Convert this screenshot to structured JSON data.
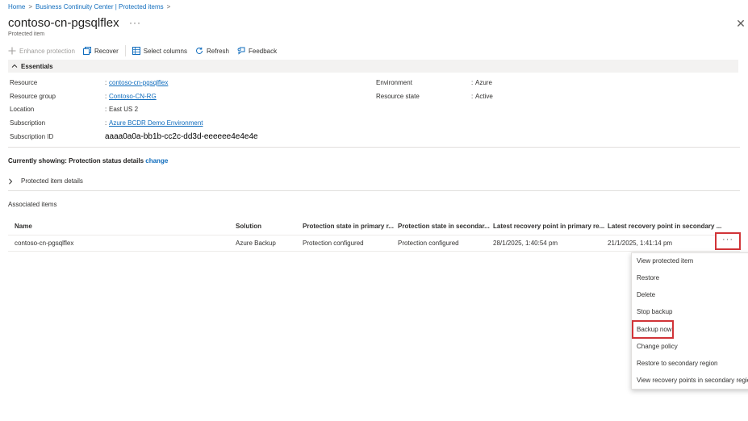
{
  "breadcrumb": {
    "home": "Home",
    "sep1": ">",
    "bcc": "Business Continuity Center | Protected items",
    "sep2": ">"
  },
  "header": {
    "title": "contoso-cn-pgsqlflex",
    "more": "···",
    "subtitle": "Protected item",
    "close": "✕"
  },
  "toolbar": {
    "enhance_protection": "Enhance protection",
    "recover": "Recover",
    "select_columns": "Select columns",
    "refresh": "Refresh",
    "feedback": "Feedback"
  },
  "essentials": {
    "title": "Essentials",
    "left": [
      {
        "label": "Resource",
        "value": "contoso-cn-pgsqlflex"
      },
      {
        "label": "Resource group",
        "value": "Contoso-CN-RG"
      },
      {
        "label": "Location",
        "value": "East US 2"
      },
      {
        "label": "Subscription",
        "value": "Azure BCDR Demo Environment"
      },
      {
        "label": "Subscription ID",
        "value": "aaaa0a0a-bb1b-cc2c-dd3d-eeeeee4e4e4e"
      }
    ],
    "right": [
      {
        "label": "Environment",
        "value": "Azure"
      },
      {
        "label": "Resource state",
        "value": "Active"
      }
    ],
    "colon": ":"
  },
  "status": {
    "prefix": "Currently showing: Protection status details",
    "change": "change"
  },
  "protected_item_details": "Protected item details",
  "associated": {
    "title": "Associated items",
    "columns": [
      "Name",
      "Solution",
      "Protection state in primary r...",
      "Protection state in secondar...",
      "Latest recovery point in primary re...",
      "Latest recovery point in secondary ..."
    ],
    "rows": [
      {
        "name": "contoso-cn-pgsqlflex",
        "solution": "Azure Backup",
        "primary_state": "Protection configured",
        "secondary_state": "Protection configured",
        "primary_rp": "28/1/2025, 1:40:54 pm",
        "secondary_rp": "21/1/2025, 1:41:14 pm",
        "more": "···"
      }
    ]
  },
  "context_menu": {
    "items": [
      "View protected item",
      "Restore",
      "Delete",
      "Stop backup",
      "Backup now",
      "Change policy",
      "Restore to secondary region",
      "View recovery points in secondary region"
    ]
  },
  "colors": {
    "link": "#0f6cbd",
    "highlight": "#d13438",
    "essentials_bg": "#f3f2f1"
  }
}
